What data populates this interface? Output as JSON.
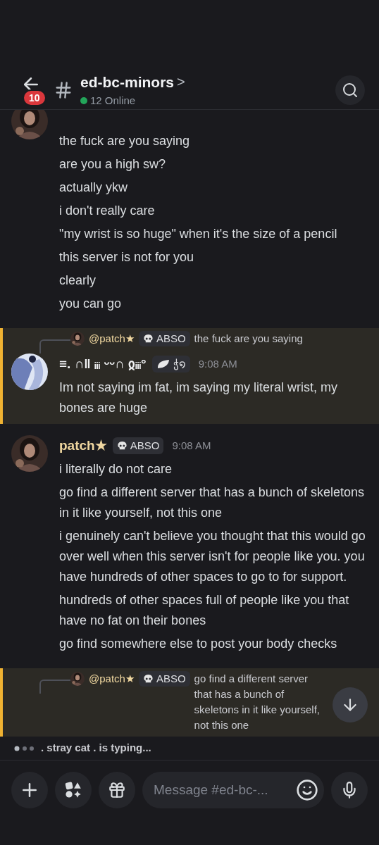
{
  "header": {
    "back_badge": "10",
    "channel": "ed-bc-minors",
    "chevron": ">",
    "online": "12 Online"
  },
  "messages": [
    {
      "avatar": {
        "kind": "dark"
      },
      "highlighted": false,
      "lines": [
        "the fuck are you saying",
        "are you a high sw?",
        "actually ykw",
        "i don't really care",
        "\"my wrist is so huge\" when it's the size of a pencil",
        "this server is not for you",
        "clearly",
        "you can go"
      ]
    },
    {
      "author": "≡. ∩‖ ᵢᵢᵢ ᵕᵕ∩ ჲᵢᵢᵢ°",
      "color": "#f2f3f5",
      "avatar": {
        "kind": "light"
      },
      "tag": {
        "kind": "leaf",
        "text": "ჭ໑"
      },
      "time": "9:08 AM",
      "highlighted": true,
      "reply": {
        "author": "@patch★",
        "tag": "ABSO",
        "text": "the fuck are you saying"
      },
      "lines": [
        "Im not saying im fat, im saying my literal wrist, my bones are huge"
      ]
    },
    {
      "author": "patch★",
      "color": "#f0d7a0",
      "avatar": {
        "kind": "dark"
      },
      "tag": {
        "kind": "skull",
        "text": "ABSO"
      },
      "time": "9:08 AM",
      "highlighted": false,
      "lines": [
        "i literally do not care",
        "go find a different server that has a bunch of skeletons in it like yourself, not this one",
        "i genuinely can't believe you thought that this would go over well when this server isn't for people like you. you have hundreds of other spaces to go to for support.",
        "hundreds of other spaces full of people like you that have no fat on their bones",
        "go find somewhere else to post your body checks"
      ]
    },
    {
      "highlighted": true,
      "reply": {
        "author": "@patch★",
        "tag": "ABSO",
        "text": "go find a different server that has a bunch of skeletons in it like yourself, not this one"
      }
    }
  ],
  "typing": ". stray cat . is typing...",
  "composer": {
    "placeholder": "Message #ed-bc-..."
  }
}
